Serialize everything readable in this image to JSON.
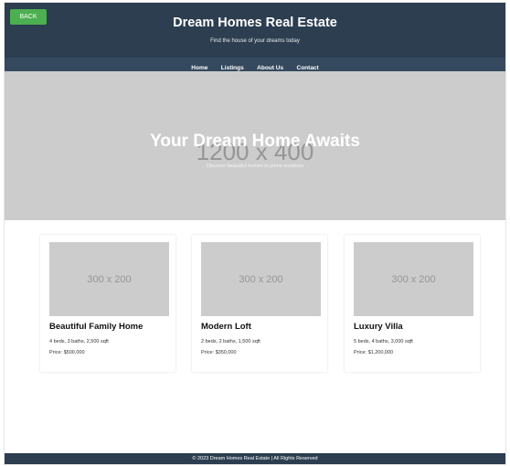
{
  "header": {
    "back_label": "BACK",
    "title": "Dream Homes Real Estate",
    "tagline": "Find the house of your dreams today"
  },
  "nav": {
    "items": [
      {
        "label": "Home"
      },
      {
        "label": "Listings"
      },
      {
        "label": "About Us"
      },
      {
        "label": "Contact"
      }
    ]
  },
  "hero": {
    "placeholder": "1200 x 400",
    "title": "Your Dream Home Awaits",
    "subtitle": "Discover beautiful homes in prime locations"
  },
  "listings": [
    {
      "image_placeholder": "300 x 200",
      "title": "Beautiful Family Home",
      "details": "4 beds, 3 baths, 2,500 sqft",
      "price": "Price: $500,000"
    },
    {
      "image_placeholder": "300 x 200",
      "title": "Modern Loft",
      "details": "2 beds, 2 baths, 1,500 sqft",
      "price": "Price: $350,000"
    },
    {
      "image_placeholder": "300 x 200",
      "title": "Luxury Villa",
      "details": "5 beds, 4 baths, 3,000 sqft",
      "price": "Price: $1,200,000"
    }
  ],
  "footer": {
    "text": "© 2023 Dream Homes Real Estate | All Rights Reserved"
  },
  "colors": {
    "header_bg": "#2c3e50",
    "nav_bg": "#34495e",
    "back_button": "#4caf50",
    "placeholder_bg": "#cccccc"
  }
}
